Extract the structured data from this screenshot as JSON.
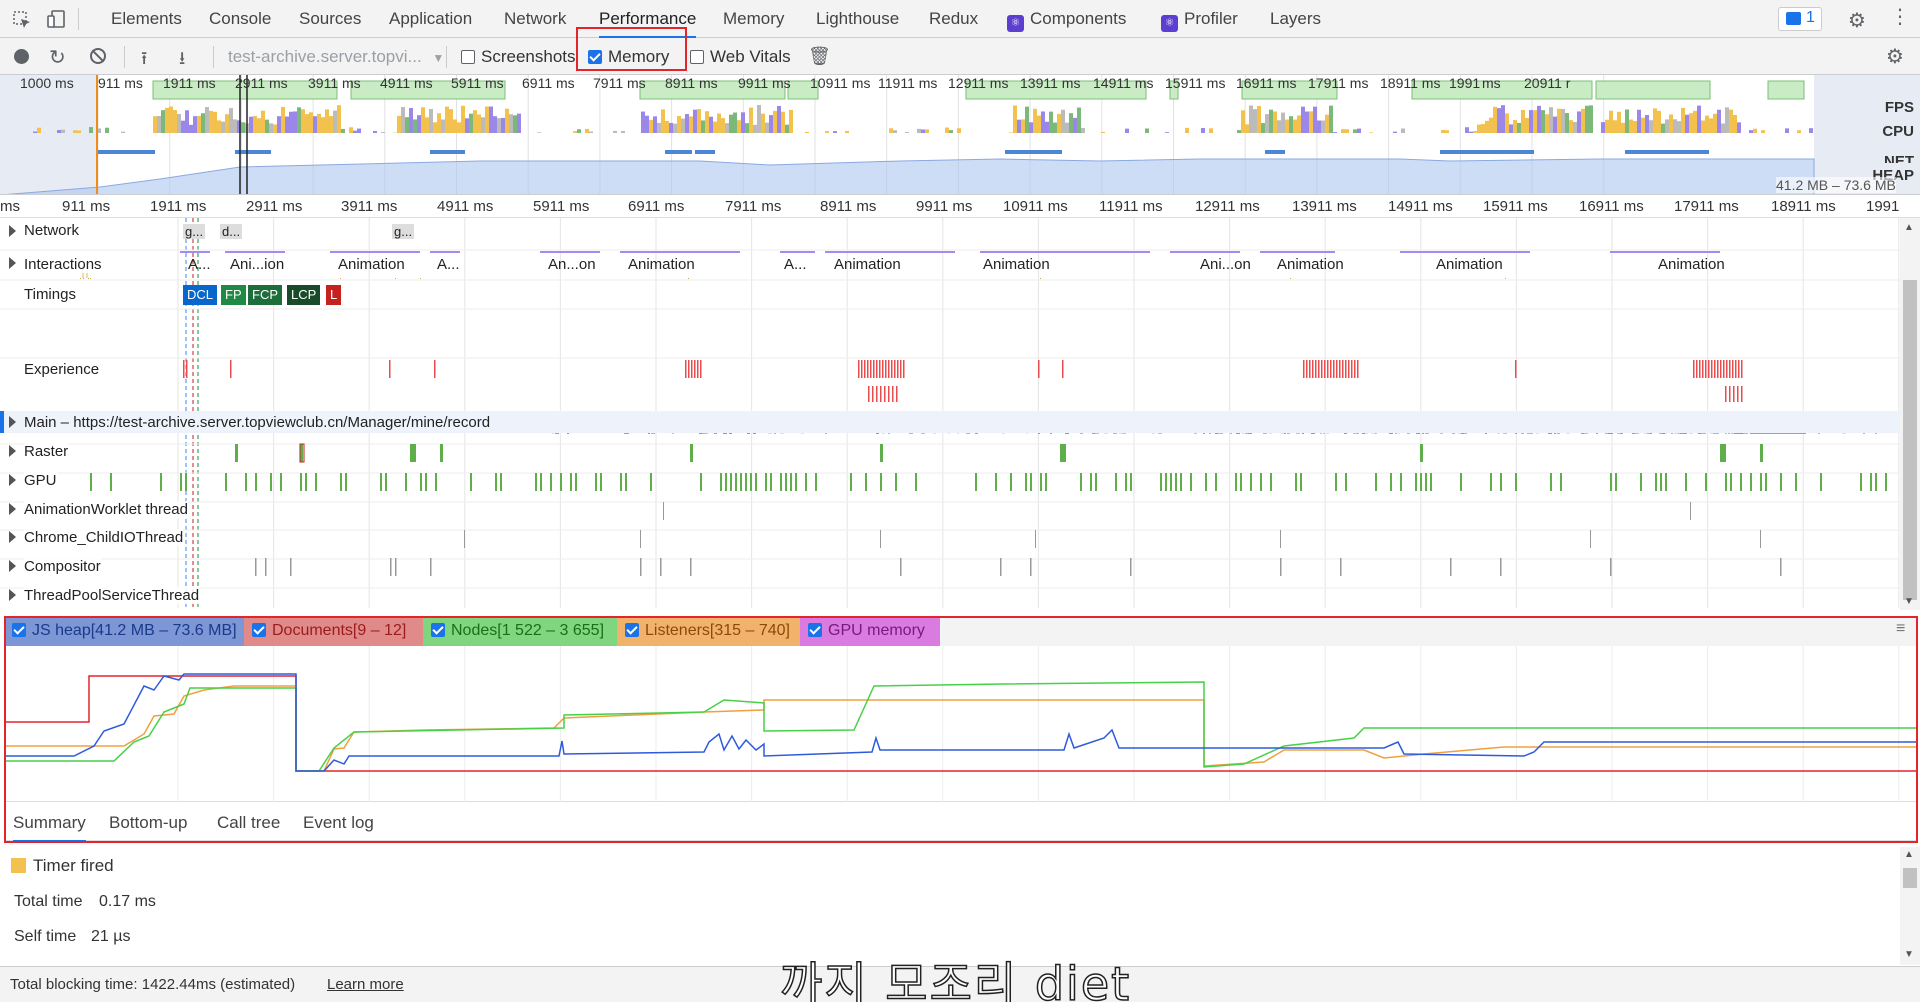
{
  "tabs": [
    "Elements",
    "Console",
    "Sources",
    "Application",
    "Network",
    "Performance",
    "Memory",
    "Lighthouse",
    "Redux",
    "Components",
    "Profiler",
    "Layers"
  ],
  "active_tab": "Performance",
  "issues_badge": "1",
  "toolbar": {
    "url_select": "test-archive.server.topvi...",
    "screenshots_label": "Screenshots",
    "memory_label": "Memory",
    "web_vitals_label": "Web Vitals",
    "screenshots_checked": false,
    "memory_checked": true,
    "web_vitals_checked": false
  },
  "overview": {
    "ticks": [
      "1000 ms",
      "911 ms",
      "1911 ms",
      "2911 ms",
      "3911 ms",
      "4911 ms",
      "5911 ms",
      "6911 ms",
      "7911 ms",
      "8911 ms",
      "9911 ms",
      "10911 ms",
      "11911 ms",
      "12911 ms",
      "13911 ms",
      "14911 ms",
      "15911 ms",
      "16911 ms",
      "17911 ms",
      "18911 ms",
      "1991",
      "ms",
      "20911 r"
    ],
    "fps_label": "FPS",
    "cpu_label": "CPU",
    "net_label": "NET",
    "heap_label": "HEAP",
    "heap_range": "41.2 MB – 73.6 MB"
  },
  "ruler": [
    "ms",
    "911 ms",
    "1911 ms",
    "2911 ms",
    "3911 ms",
    "4911 ms",
    "5911 ms",
    "6911 ms",
    "7911 ms",
    "8911 ms",
    "9911 ms",
    "10911 ms",
    "11911 ms",
    "12911 ms",
    "13911 ms",
    "14911 ms",
    "15911 ms",
    "16911 ms",
    "17911 ms",
    "18911 ms",
    "1991"
  ],
  "tracks": {
    "network": "Network",
    "network_items": [
      "g...",
      "d...",
      "g..."
    ],
    "interactions": "Interactions",
    "interaction_items": [
      "A...",
      "Ani...ion",
      "Animation",
      "A...",
      "An...on",
      "Animation",
      "A...",
      "Animation",
      "Animation",
      "Ani...on",
      "Animation",
      "Animation",
      "Animation"
    ],
    "timings": "Timings",
    "timing_marks": [
      {
        "label": "DCL",
        "color": "#0867cb"
      },
      {
        "label": "FP",
        "color": "#1e8a43"
      },
      {
        "label": "FCP",
        "color": "#1c6e3a"
      },
      {
        "label": "LCP",
        "color": "#184b2a"
      },
      {
        "label": "L",
        "color": "#c5221f"
      }
    ],
    "experience": "Experience",
    "main": "Main – https://test-archive.server.topviewclub.cn/Manager/mine/record",
    "raster": "Raster",
    "gpu": "GPU",
    "animation_worklet": "AnimationWorklet thread",
    "child_io": "Chrome_ChildIOThread",
    "compositor": "Compositor",
    "thread_pool": "ThreadPoolServiceThread"
  },
  "memory_legend": [
    {
      "label": "JS heap",
      "range": "[41.2 MB – 73.6 MB]",
      "bg": "#7d96d6",
      "text": "#1a3a8a",
      "checked": true
    },
    {
      "label": "Documents",
      "range": "[9 – 12]",
      "bg": "#e08a8a",
      "text": "#9b1c1c",
      "checked": true
    },
    {
      "label": "Nodes",
      "range": "[1 522 – 3 655]",
      "bg": "#7fd67f",
      "text": "#1a6e1a",
      "checked": true
    },
    {
      "label": "Listeners",
      "range": "[315 – 740]",
      "bg": "#f1b36c",
      "text": "#8c4a06",
      "checked": true
    },
    {
      "label": "GPU memory",
      "range": "",
      "bg": "#d97be0",
      "text": "#7a1a80",
      "checked": true
    }
  ],
  "bottom_tabs": [
    "Summary",
    "Bottom-up",
    "Call tree",
    "Event log"
  ],
  "active_bottom_tab": "Summary",
  "summary": {
    "event_name": "Timer fired",
    "event_color": "#f2c14e",
    "total_time_label": "Total time",
    "total_time": "0.17 ms",
    "self_time_label": "Self time",
    "self_time": "21 µs"
  },
  "status": {
    "blocking": "Total blocking time: 1422.44ms (estimated)",
    "learn_more": "Learn more"
  },
  "caption": "까지 모조리 diet"
}
